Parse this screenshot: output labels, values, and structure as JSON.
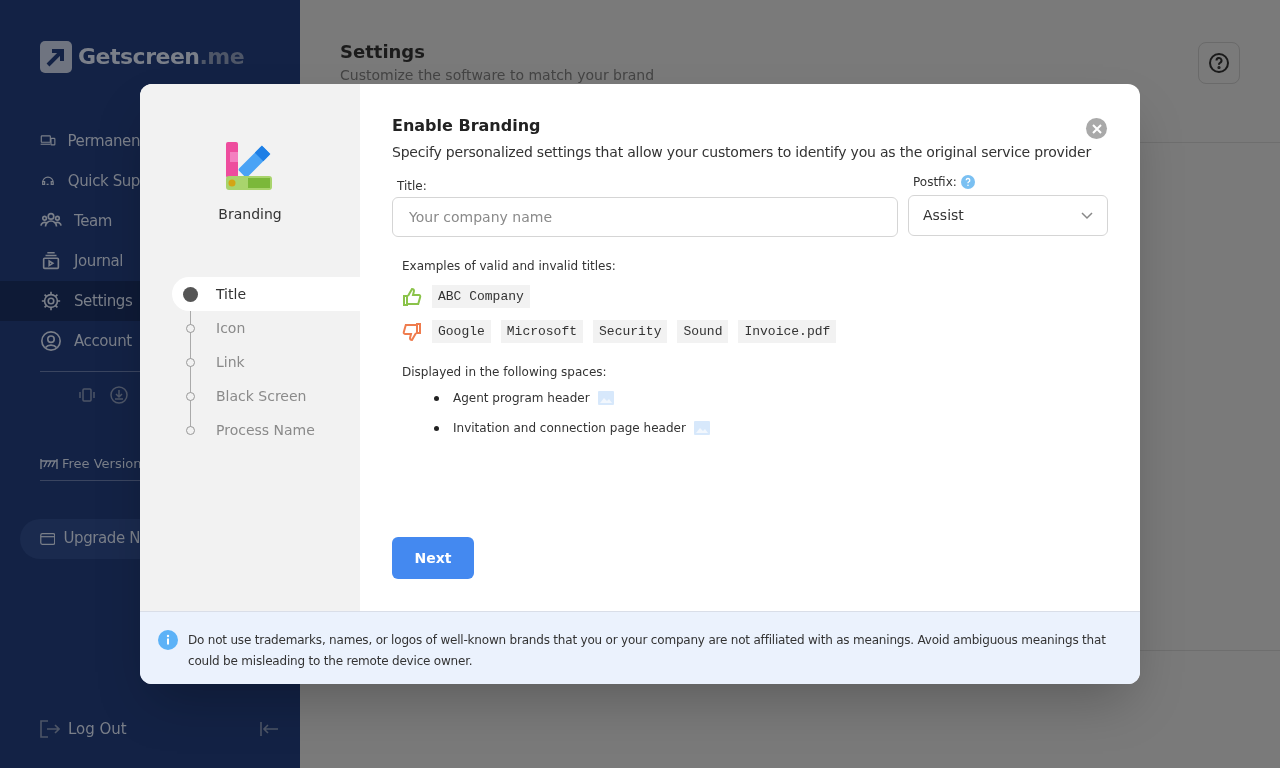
{
  "sidebar": {
    "logo": {
      "name": "Getscreen",
      "suffix": ".me"
    },
    "items": [
      {
        "label": "Permanen",
        "selected": false
      },
      {
        "label": "Quick Sup",
        "selected": false
      },
      {
        "label": "Team",
        "selected": false
      },
      {
        "label": "Journal",
        "selected": false
      },
      {
        "label": "Settings",
        "selected": true
      },
      {
        "label": "Account",
        "selected": false
      }
    ],
    "plan": "Free Version",
    "upgrade": "Upgrade N",
    "logout": "Log Out"
  },
  "page": {
    "title": "Settings",
    "subtitle": "Customize the software to match your brand"
  },
  "dialog": {
    "section": "Branding",
    "steps": [
      {
        "label": "Title",
        "selected": true
      },
      {
        "label": "Icon",
        "selected": false
      },
      {
        "label": "Link",
        "selected": false
      },
      {
        "label": "Black Screen",
        "selected": false
      },
      {
        "label": "Process Name",
        "selected": false
      }
    ],
    "title": "Enable Branding",
    "description": "Specify personalized settings that allow your customers to identify you as the original service provider",
    "title_field": {
      "label": "Title:",
      "placeholder": "Your company name"
    },
    "postfix_field": {
      "label": "Postfix:",
      "value": "Assist"
    },
    "examples_heading": "Examples of valid and invalid titles:",
    "valid": [
      "ABC Company"
    ],
    "invalid": [
      "Google",
      "Microsoft",
      "Security",
      "Sound",
      "Invoice.pdf"
    ],
    "spaces_heading": "Displayed in the following spaces:",
    "spaces": [
      "Agent program header",
      "Invitation and connection page header"
    ],
    "next": "Next",
    "notice": "Do not use trademarks, names, or logos of well-known brands that you or your company are not affiliated with as meanings. Avoid ambiguous meanings that could be misleading to the remote device owner."
  }
}
